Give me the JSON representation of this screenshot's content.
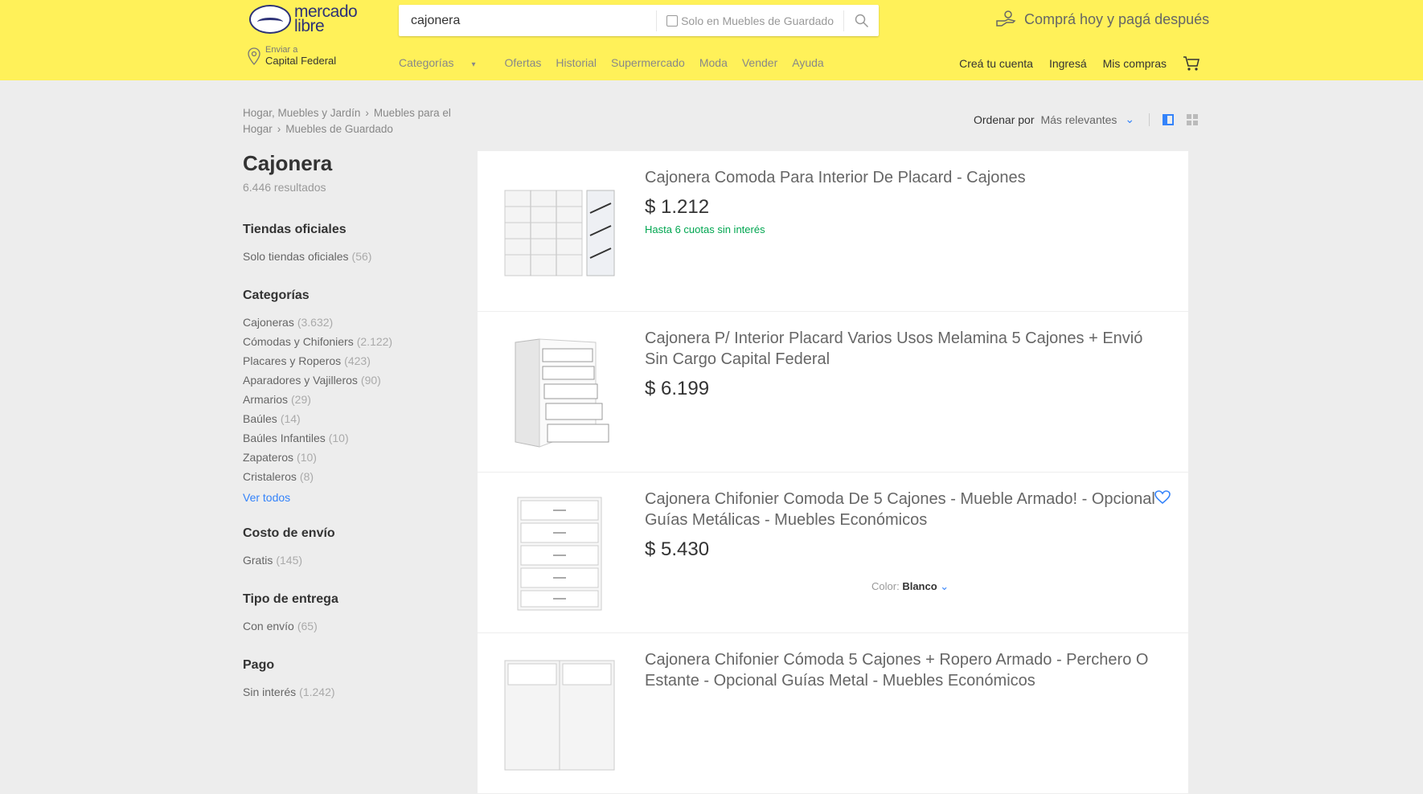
{
  "header": {
    "logo_line1": "mercado",
    "logo_line2": "libre",
    "search": {
      "value": "cajonera",
      "filter_label": "Solo en Muebles de Guardado"
    },
    "promo": "Comprá hoy y pagá después",
    "location": {
      "label": "Enviar a",
      "city": "Capital Federal"
    },
    "nav": [
      "Categorías",
      "Ofertas",
      "Historial",
      "Supermercado",
      "Moda",
      "Vender",
      "Ayuda"
    ],
    "user_nav": [
      "Creá tu cuenta",
      "Ingresá",
      "Mis compras"
    ]
  },
  "breadcrumb": [
    "Hogar, Muebles y Jardín",
    "Muebles para el Hogar",
    "Muebles de Guardado"
  ],
  "sort": {
    "label": "Ordenar por",
    "value": "Más relevantes"
  },
  "query": {
    "title": "Cajonera",
    "results": "6.446 resultados"
  },
  "filters": [
    {
      "title": "Tiendas oficiales",
      "items": [
        {
          "label": "Solo tiendas oficiales",
          "count": "(56)"
        }
      ]
    },
    {
      "title": "Categorías",
      "items": [
        {
          "label": "Cajoneras",
          "count": "(3.632)"
        },
        {
          "label": "Cómodas y Chifoniers",
          "count": "(2.122)"
        },
        {
          "label": "Placares y Roperos",
          "count": "(423)"
        },
        {
          "label": "Aparadores y Vajilleros",
          "count": "(90)"
        },
        {
          "label": "Armarios",
          "count": "(29)"
        },
        {
          "label": "Baúles",
          "count": "(14)"
        },
        {
          "label": "Baúles Infantiles",
          "count": "(10)"
        },
        {
          "label": "Zapateros",
          "count": "(10)"
        },
        {
          "label": "Cristaleros",
          "count": "(8)"
        }
      ],
      "see_all": "Ver todos"
    },
    {
      "title": "Costo de envío",
      "items": [
        {
          "label": "Gratis",
          "count": "(145)"
        }
      ]
    },
    {
      "title": "Tipo de entrega",
      "items": [
        {
          "label": "Con envío",
          "count": "(65)"
        }
      ]
    },
    {
      "title": "Pago",
      "items": [
        {
          "label": "Sin interés",
          "count": "(1.242)"
        }
      ]
    }
  ],
  "products": [
    {
      "title": "Cajonera Comoda Para Interior De Placard - Cajones",
      "price": "$ 1.212",
      "installments": "Hasta 6 cuotas sin interés",
      "icon": "drawer-unit-open"
    },
    {
      "title": "Cajonera P/ Interior Placard Varios Usos Melamina 5 Cajones + Envió Sin Cargo Capital Federal",
      "price": "$ 6.199",
      "icon": "drawer-unit-5"
    },
    {
      "title": "Cajonera Chifonier Comoda De 5 Cajones - Mueble Armado! - Opcional Guías Metálicas - Muebles Económicos",
      "price": "$ 5.430",
      "color_label": "Color:",
      "color_value": "Blanco",
      "icon": "chifonier-5"
    },
    {
      "title": "Cajonera Chifonier Cómoda 5 Cajones + Ropero Armado - Perchero O Estante - Opcional Guías Metal - Muebles Económicos",
      "price": "",
      "icon": "chifonier-ropero"
    }
  ]
}
